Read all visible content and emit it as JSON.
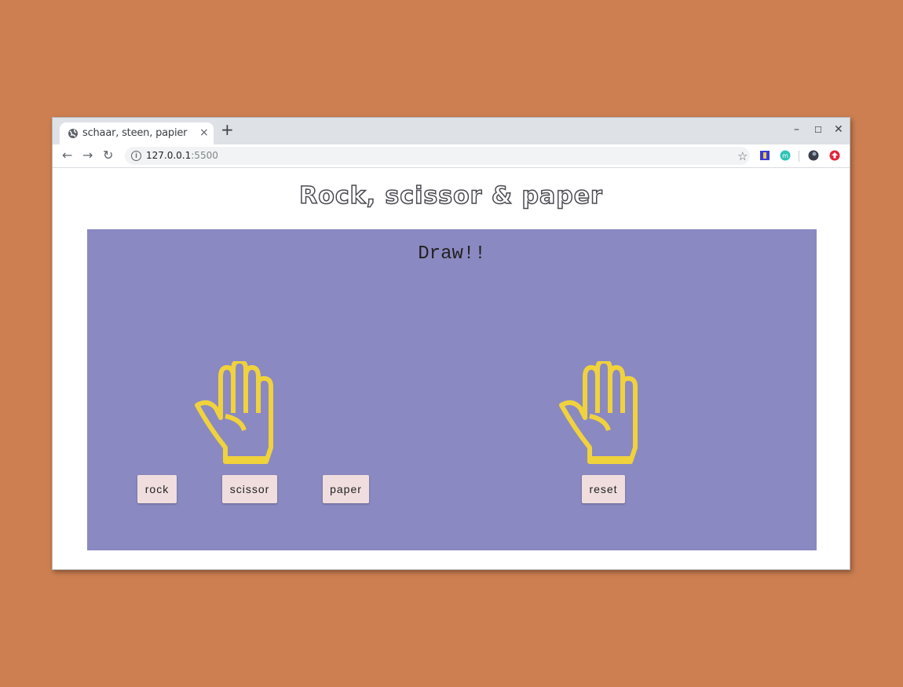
{
  "browser": {
    "tab_title": "schaar, steen, papier",
    "tab_close": "×",
    "new_tab": "+",
    "url_host": "127.0.0.1",
    "url_port": ":5500",
    "window_controls": {
      "minimize": "–",
      "maximize": "☐",
      "close": "✕"
    }
  },
  "page": {
    "heading": "Rock, scissor & paper",
    "result": "Draw!!",
    "buttons": {
      "rock": "rock",
      "scissor": "scissor",
      "paper": "paper",
      "reset": "reset"
    },
    "player_choice_icon": "hand-paper-icon",
    "computer_choice_icon": "hand-paper-icon"
  },
  "colors": {
    "backdrop": "#cd7f51",
    "game_panel": "#8b89c1",
    "hand": "#f0d23c",
    "button": "#f0dede"
  }
}
